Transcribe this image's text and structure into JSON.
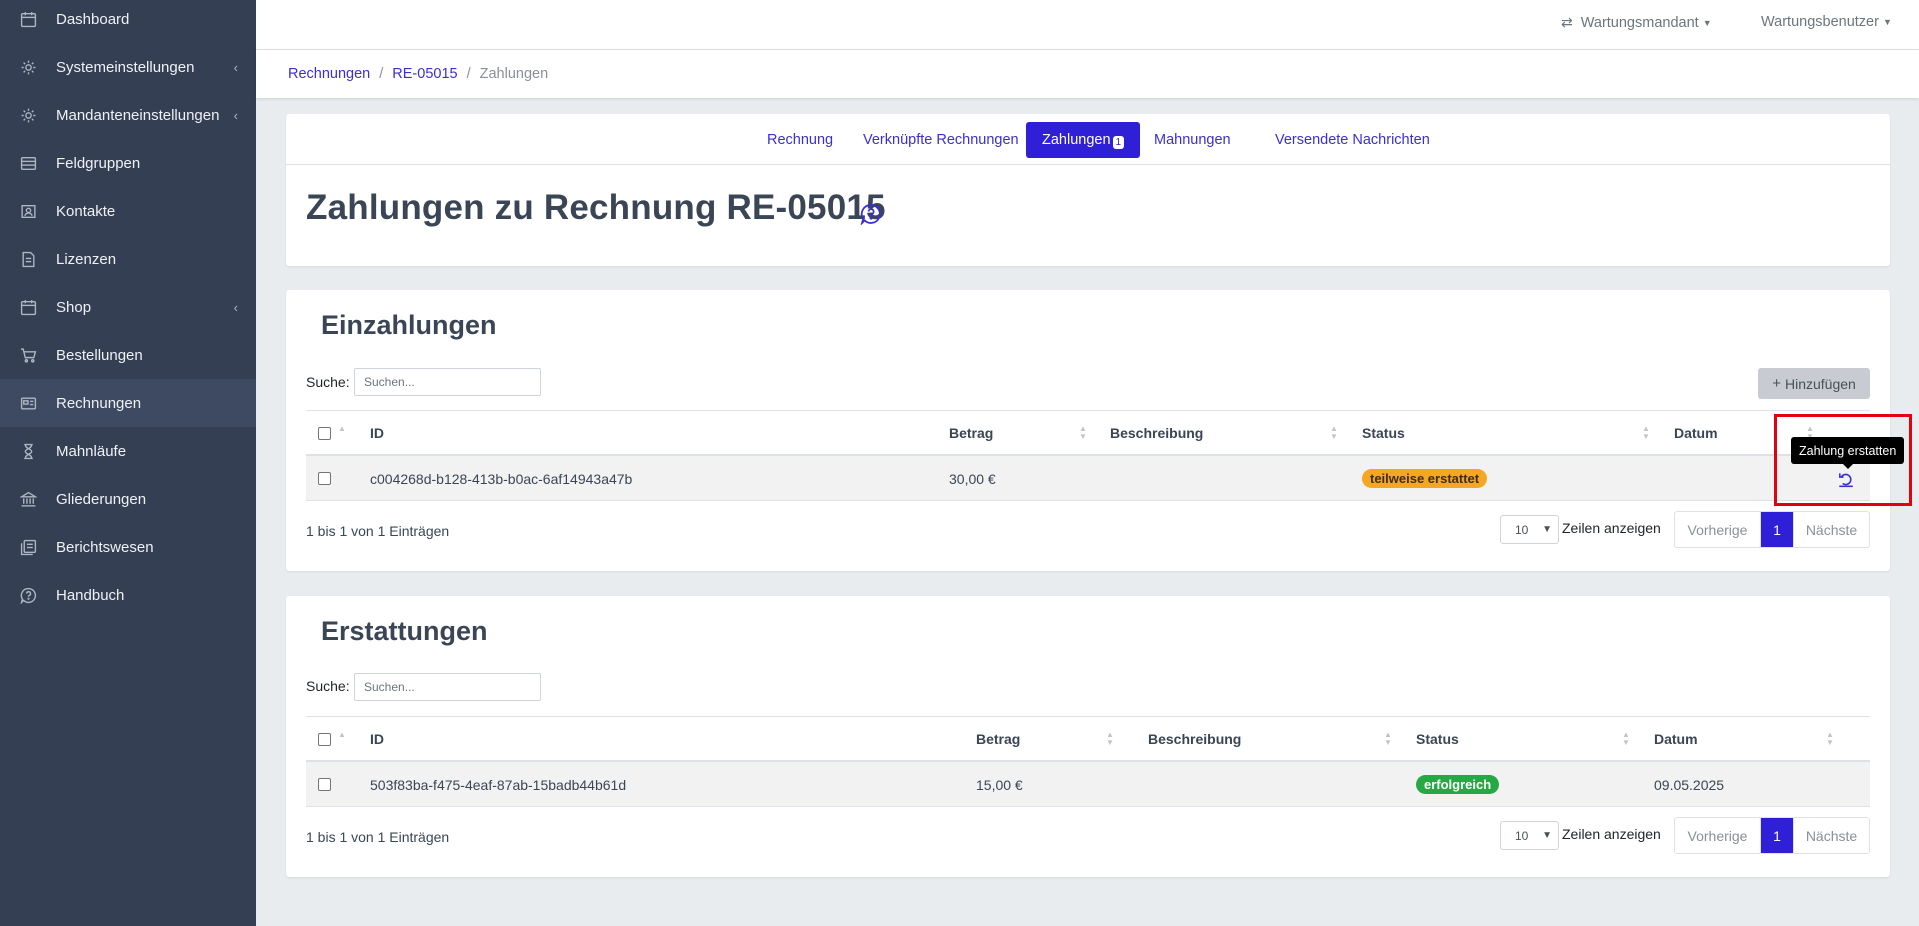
{
  "sidebar": {
    "items": [
      {
        "label": "Dashboard",
        "icon": "calendar-icon",
        "chevron": ""
      },
      {
        "label": "Systemeinstellungen",
        "icon": "gear-icon",
        "chevron": "‹"
      },
      {
        "label": "Mandanteneinstellungen",
        "icon": "gear-icon",
        "chevron": "‹"
      },
      {
        "label": "Feldgruppen",
        "icon": "list-icon",
        "chevron": ""
      },
      {
        "label": "Kontakte",
        "icon": "contact-book-icon",
        "chevron": ""
      },
      {
        "label": "Lizenzen",
        "icon": "document-icon",
        "chevron": ""
      },
      {
        "label": "Shop",
        "icon": "calendar-icon",
        "chevron": "‹"
      },
      {
        "label": "Bestellungen",
        "icon": "cart-icon",
        "chevron": ""
      },
      {
        "label": "Rechnungen",
        "icon": "invoice-icon",
        "chevron": "",
        "active": true
      },
      {
        "label": "Mahnläufe",
        "icon": "hourglass-icon",
        "chevron": ""
      },
      {
        "label": "Gliederungen",
        "icon": "bank-icon",
        "chevron": ""
      },
      {
        "label": "Berichtswesen",
        "icon": "report-icon",
        "chevron": ""
      },
      {
        "label": "Handbuch",
        "icon": "help-chat-icon",
        "chevron": ""
      }
    ]
  },
  "topbar": {
    "tenant": "Wartungsmandant",
    "user": "Wartungsbenutzer"
  },
  "breadcrumb": {
    "items": [
      "Rechnungen",
      "RE-05015"
    ],
    "current": "Zahlungen"
  },
  "tabs": {
    "items": [
      "Rechnung",
      "Verknüpfte Rechnungen",
      "Zahlungen",
      "Mahnungen",
      "Versendete Nachrichten"
    ],
    "active_badge": "1"
  },
  "page": {
    "title": "Zahlungen zu Rechnung RE-05015"
  },
  "deposits": {
    "title": "Einzahlungen",
    "search_label": "Suche:",
    "search_placeholder": "Suchen...",
    "add_label": "Hinzufügen",
    "columns": [
      "ID",
      "Betrag",
      "Beschreibung",
      "Status",
      "Datum"
    ],
    "rows": [
      {
        "id": "c004268d-b128-413b-b0ac-6af14943a47b",
        "amount": "30,00 €",
        "description": "",
        "status": "teilweise erstattet",
        "date": ""
      }
    ],
    "info": "1 bis 1 von 1 Einträgen",
    "page_length": "10",
    "length_label": "Zeilen anzeigen",
    "prev": "Vorherige",
    "page": "1",
    "next": "Nächste",
    "tooltip": "Zahlung erstatten"
  },
  "refunds": {
    "title": "Erstattungen",
    "search_label": "Suche:",
    "search_placeholder": "Suchen...",
    "columns": [
      "ID",
      "Betrag",
      "Beschreibung",
      "Status",
      "Datum"
    ],
    "rows": [
      {
        "id": "503f83ba-f475-4eaf-87ab-15badb44b61d",
        "amount": "15,00 €",
        "description": "",
        "status": "erfolgreich",
        "date": "09.05.2025"
      }
    ],
    "info": "1 bis 1 von 1 Einträgen",
    "page_length": "10",
    "length_label": "Zeilen anzeigen",
    "prev": "Vorherige",
    "page": "1",
    "next": "Nächste"
  },
  "colors": {
    "sidebar_bg": "#343f54",
    "accent": "#2f1fd6",
    "warning": "#f5a623",
    "success": "#28a745",
    "highlight": "#e3000f"
  }
}
